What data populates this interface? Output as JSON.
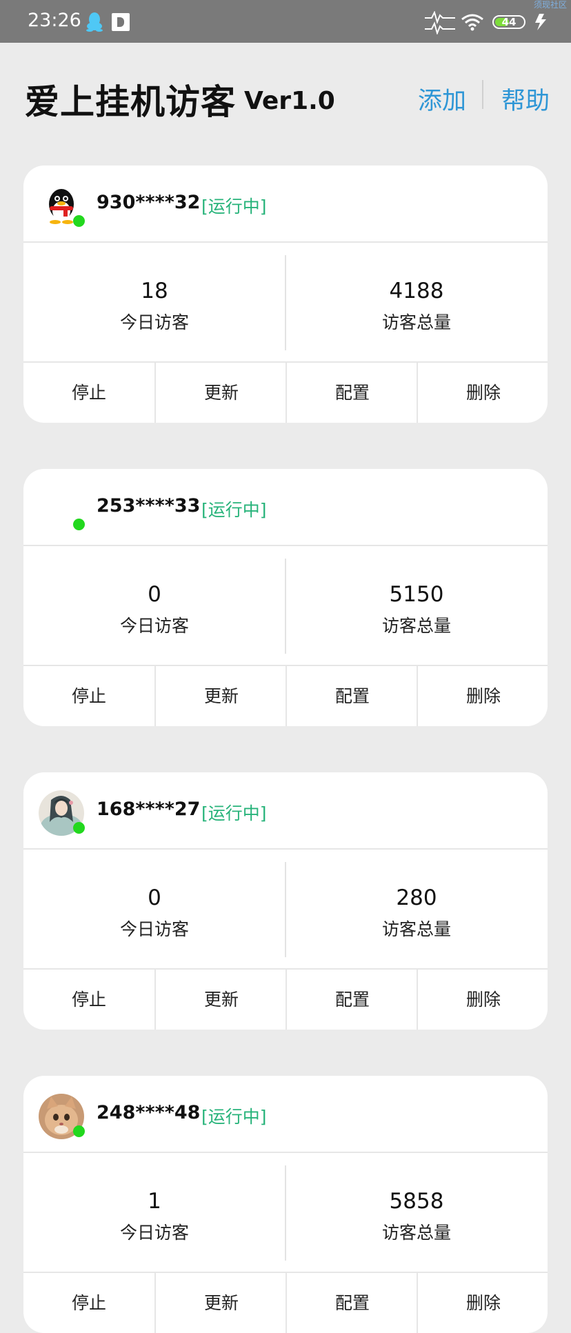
{
  "status_bar": {
    "time": "23:26",
    "battery": "44",
    "corner_text": "须现社区",
    "icons": [
      "qq-icon",
      "app-icon",
      "signal-icon",
      "wifi-icon",
      "battery-icon",
      "charging-icon"
    ]
  },
  "header": {
    "title": "爱上挂机访客",
    "version": "Ver1.0",
    "add_label": "添加",
    "help_label": "帮助"
  },
  "colors": {
    "accent": "#2e96d6",
    "status_running": "#27b37a",
    "online_dot": "#22d81e",
    "background": "#ebebeb"
  },
  "accounts": [
    {
      "account": "930****32",
      "status": "[运行中]",
      "avatar": "penguin-avatar",
      "today_value": "18",
      "today_label": "今日访客",
      "total_value": "4188",
      "total_label": "访客总量",
      "actions": [
        "停止",
        "更新",
        "配置",
        "删除"
      ]
    },
    {
      "account": "253****33",
      "status": "[运行中]",
      "avatar": "blank-avatar",
      "today_value": "0",
      "today_label": "今日访客",
      "total_value": "5150",
      "total_label": "访客总量",
      "actions": [
        "停止",
        "更新",
        "配置",
        "删除"
      ]
    },
    {
      "account": "168****27",
      "status": "[运行中]",
      "avatar": "girl-avatar",
      "today_value": "0",
      "today_label": "今日访客",
      "total_value": "280",
      "total_label": "访客总量",
      "actions": [
        "停止",
        "更新",
        "配置",
        "删除"
      ]
    },
    {
      "account": "248****48",
      "status": "[运行中]",
      "avatar": "cat-avatar",
      "today_value": "1",
      "today_label": "今日访客",
      "total_value": "5858",
      "total_label": "访客总量",
      "actions": [
        "停止",
        "更新",
        "配置",
        "删除"
      ]
    }
  ]
}
